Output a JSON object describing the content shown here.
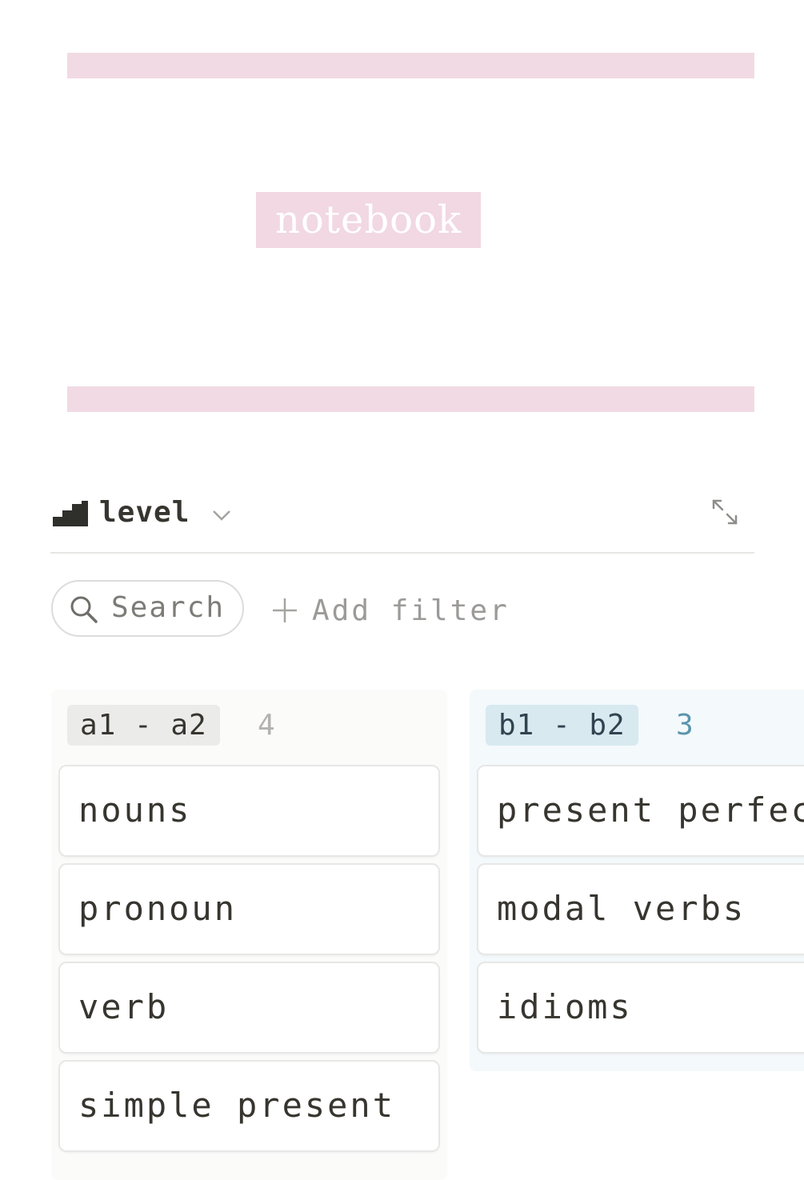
{
  "cover": {
    "title": "notebook",
    "accent_color": "#f1d8e2"
  },
  "view": {
    "icon": "stairs-icon",
    "title": "level",
    "dropdown_icon": "chevron-down-icon",
    "expand_icon": "expand-icon"
  },
  "toolbar": {
    "search_label": "Search",
    "add_filter_label": "Add filter"
  },
  "board": {
    "columns": [
      {
        "tag": "a1 - a2",
        "count": "4",
        "tag_color": "#ebebea",
        "cards": [
          "nouns",
          "pronoun",
          "verb",
          "simple present"
        ]
      },
      {
        "tag": "b1 - b2",
        "count": "3",
        "tag_color": "#d8e9f0",
        "cards": [
          "present perfect",
          "modal verbs",
          "idioms"
        ]
      }
    ]
  }
}
